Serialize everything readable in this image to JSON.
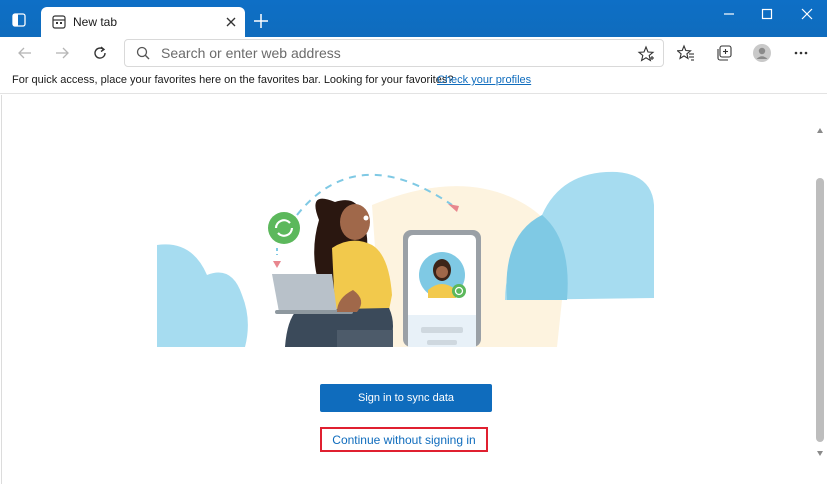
{
  "browser": {
    "tab": {
      "title": "New tab"
    },
    "address_bar": {
      "placeholder": "Search or enter web address",
      "value": ""
    }
  },
  "favorites_bar": {
    "message": "For quick access, place your favorites here on the favorites bar. Looking for your favorites?",
    "link": "Check your profiles"
  },
  "sync_page": {
    "signin_button": "Sign in to sync data",
    "continue_link": "Continue without signing in"
  },
  "colors": {
    "titlebar": "#0f6cbd",
    "accent": "#0f6cbd",
    "highlight_box": "#e02030",
    "cloud": "#a6dcf0",
    "sync_green": "#5cb85c"
  }
}
